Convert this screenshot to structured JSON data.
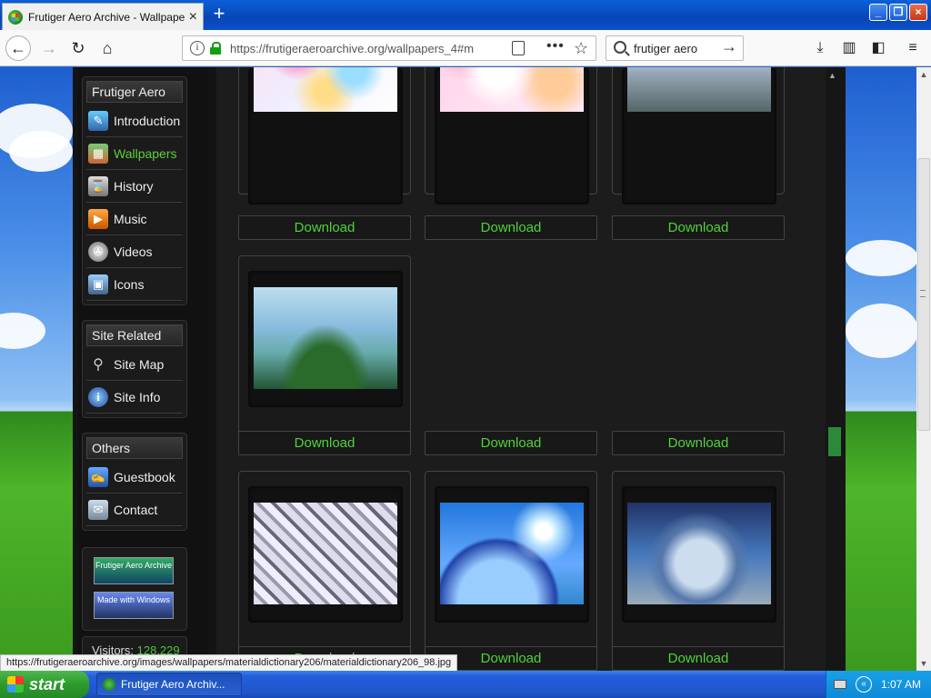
{
  "browser": {
    "tab_title": "Frutiger Aero Archive - Wallpapers",
    "url": "https://frutigeraeroarchive.org/wallpapers_4#m",
    "search_value": "frutiger aero",
    "status_url": "https://frutigeraeroarchive.org/images/wallpapers/materialdictionary206/materialdictionary206_98.jpg"
  },
  "sidebar": {
    "sections": [
      {
        "heading": "Frutiger Aero",
        "items": [
          {
            "label": "Introduction",
            "icon": "introduction-icon",
            "active": false
          },
          {
            "label": "Wallpapers",
            "icon": "wallpapers-icon",
            "active": true
          },
          {
            "label": "History",
            "icon": "history-icon",
            "active": false
          },
          {
            "label": "Music",
            "icon": "music-icon",
            "active": false
          },
          {
            "label": "Videos",
            "icon": "videos-icon",
            "active": false
          },
          {
            "label": "Icons",
            "icon": "icons-icon",
            "active": false
          }
        ]
      },
      {
        "heading": "Site Related",
        "items": [
          {
            "label": "Site Map",
            "icon": "sitemap-icon",
            "active": false
          },
          {
            "label": "Site Info",
            "icon": "info-icon",
            "active": false
          }
        ]
      },
      {
        "heading": "Others",
        "items": [
          {
            "label": "Guestbook",
            "icon": "guestbook-icon",
            "active": false
          },
          {
            "label": "Contact",
            "icon": "contact-icon",
            "active": false
          }
        ]
      }
    ],
    "badges": {
      "archive_badge": "Frutiger Aero Archive",
      "windows_badge": "Made with Windows"
    },
    "visitors_label": "Visitors:",
    "visitors_count": "128,229"
  },
  "gallery": {
    "download_label": "Download"
  },
  "taskbar": {
    "start_label": "start",
    "task_label": "Frutiger Aero Archiv...",
    "clock": "1:07 AM"
  }
}
